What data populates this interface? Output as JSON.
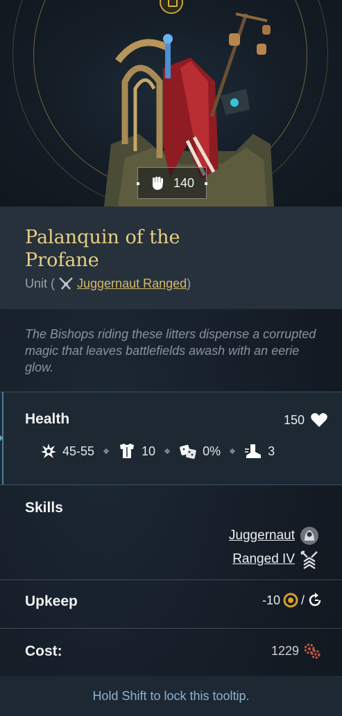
{
  "portrait": {
    "power_value": "140",
    "power_icon": "fist-icon"
  },
  "unit": {
    "name": "Palanquin of the Profane",
    "type_prefix": "Unit (",
    "class_icon": "juggernaut-ranged-icon",
    "class_link": "Juggernaut Ranged",
    "type_suffix": ")",
    "flavor": "The Bishops riding these litters dispense a corrupted magic that leaves battlefields awash with an eerie glow."
  },
  "stats": {
    "health_label": "Health",
    "health_value": "150",
    "damage": "45-55",
    "defense": "10",
    "status_chance": "0%",
    "movement": "3"
  },
  "skills": {
    "label": "Skills",
    "items": [
      {
        "name": "Juggernaut",
        "icon": "juggernaut-icon"
      },
      {
        "name": "Ranged IV",
        "icon": "ranged-icon"
      }
    ]
  },
  "upkeep": {
    "label": "Upkeep",
    "value": "-10",
    "separator": "/"
  },
  "cost": {
    "label": "Cost:",
    "value": "1229"
  },
  "footer": {
    "hint": "Hold Shift to lock this tooltip."
  },
  "colors": {
    "title_gold": "#e7cf86",
    "link_gold": "#d7b96a",
    "gold_currency": "#d6a324",
    "production_red": "#d0573f",
    "hint_blue": "#8fb3cb"
  }
}
